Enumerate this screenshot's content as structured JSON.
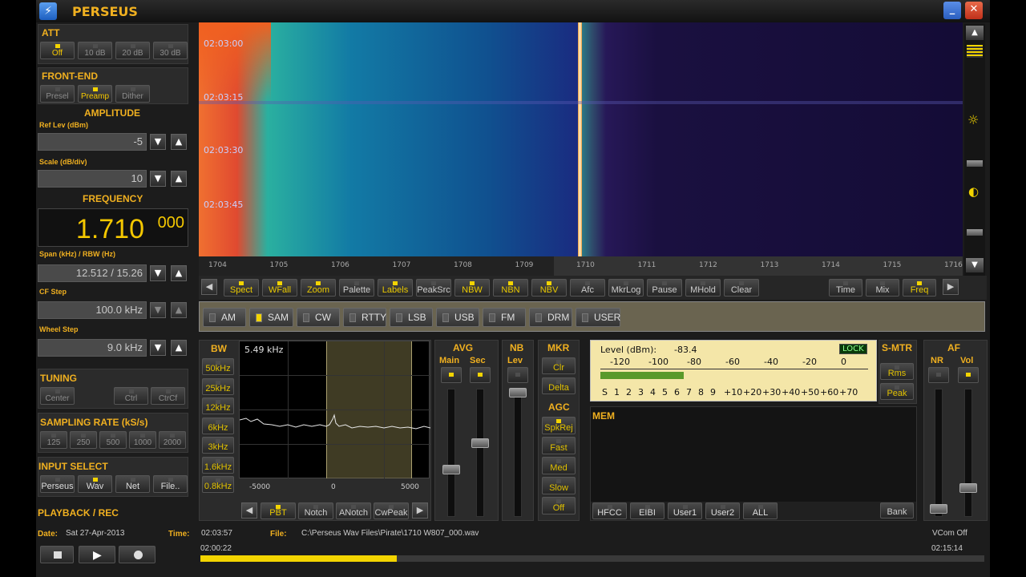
{
  "app": {
    "title": "PERSEUS"
  },
  "att": {
    "title": "ATT",
    "buttons": [
      {
        "label": "Off",
        "on": true
      },
      {
        "label": "10 dB",
        "on": false
      },
      {
        "label": "20 dB",
        "on": false
      },
      {
        "label": "30 dB",
        "on": false
      }
    ]
  },
  "frontend": {
    "title": "FRONT-END",
    "buttons": [
      {
        "label": "Presel",
        "on": false
      },
      {
        "label": "Preamp",
        "on": true
      },
      {
        "label": "Dither",
        "on": false
      }
    ]
  },
  "amplitude": {
    "title": "AMPLITUDE",
    "ref_label": "Ref Lev (dBm)",
    "ref_value": "-5",
    "scale_label": "Scale (dB/div)",
    "scale_value": "10"
  },
  "frequency": {
    "title": "FREQUENCY",
    "main": "1.710",
    "sub": "000",
    "span_label": "Span (kHz) / RBW (Hz)",
    "span_value": "12.512 / 15.26",
    "cf_label": "CF Step",
    "cf_value": "100.0 kHz",
    "wheel_label": "Wheel Step",
    "wheel_value": "9.0 kHz"
  },
  "tuning": {
    "title": "TUNING",
    "buttons": [
      "Center",
      "Ctrl",
      "CtrCf"
    ]
  },
  "sampling": {
    "title": "SAMPLING RATE (kS/s)",
    "buttons": [
      "125",
      "250",
      "500",
      "1000",
      "2000"
    ]
  },
  "input": {
    "title": "INPUT SELECT",
    "buttons": [
      {
        "label": "Perseus",
        "on": false
      },
      {
        "label": "Wav",
        "on": true
      },
      {
        "label": "Net",
        "on": false
      },
      {
        "label": "File..",
        "on": false
      }
    ]
  },
  "playback": {
    "title": "PLAYBACK / REC"
  },
  "waterfall": {
    "times": [
      "02:03:00",
      "02:03:15",
      "02:03:30",
      "02:03:45"
    ],
    "freq_ticks": [
      "1704",
      "1705",
      "1706",
      "1707",
      "1708",
      "1709",
      "1710",
      "1711",
      "1712",
      "1713",
      "1714",
      "1715",
      "1716"
    ]
  },
  "toolbar": {
    "buttons": [
      {
        "label": "Spect",
        "on": true
      },
      {
        "label": "WFall",
        "on": true
      },
      {
        "label": "Zoom",
        "on": true
      },
      {
        "label": "Palette",
        "on": false
      },
      {
        "label": "Labels",
        "on": true
      },
      {
        "label": "PeakSrc",
        "on": false
      },
      {
        "label": "NBW",
        "on": true
      },
      {
        "label": "NBN",
        "on": true
      },
      {
        "label": "NBV",
        "on": true
      },
      {
        "label": "Afc",
        "on": false
      },
      {
        "label": "MkrLog",
        "on": false
      },
      {
        "label": "Pause",
        "on": false
      },
      {
        "label": "MHold",
        "on": false
      },
      {
        "label": "Clear",
        "on": false
      }
    ],
    "right": [
      {
        "label": "Time",
        "on": false
      },
      {
        "label": "Mix",
        "on": false
      },
      {
        "label": "Freq",
        "on": true
      }
    ]
  },
  "modes": [
    {
      "label": "AM",
      "on": false
    },
    {
      "label": "SAM",
      "on": true
    },
    {
      "label": "CW",
      "on": false
    },
    {
      "label": "RTTY",
      "on": false
    },
    {
      "label": "LSB",
      "on": false
    },
    {
      "label": "USB",
      "on": false
    },
    {
      "label": "FM",
      "on": false
    },
    {
      "label": "DRM",
      "on": false
    },
    {
      "label": "USER",
      "on": false
    }
  ],
  "bw": {
    "title": "BW",
    "display": "5.49 kHz",
    "buttons": [
      "50kHz",
      "25kHz",
      "12kHz",
      "6kHz",
      "3kHz",
      "1.6kHz",
      "0.8kHz"
    ],
    "axis": [
      "-5000",
      "0",
      "5000"
    ]
  },
  "filter_buttons": [
    {
      "label": "PBT",
      "on": true
    },
    {
      "label": "Notch",
      "on": false
    },
    {
      "label": "ANotch",
      "on": false
    },
    {
      "label": "CwPeak",
      "on": false
    }
  ],
  "avg": {
    "title": "AVG",
    "main": "Main",
    "sec": "Sec"
  },
  "nb": {
    "title": "NB",
    "lev": "Lev"
  },
  "mkr": {
    "title": "MKR",
    "buttons": [
      "Clr",
      "Delta"
    ]
  },
  "agc": {
    "title": "AGC",
    "buttons": [
      {
        "label": "SpkRej",
        "on": true
      },
      {
        "label": "Fast",
        "on": false
      },
      {
        "label": "Med",
        "on": false
      },
      {
        "label": "Slow",
        "on": false
      },
      {
        "label": "Off",
        "on": false
      }
    ]
  },
  "meter": {
    "level_label": "Level (dBm):",
    "level_value": "-83.4",
    "lock": "LOCK",
    "dbm_scale": [
      "-120",
      "-100",
      "-80",
      "-60",
      "-40",
      "-20",
      "0"
    ],
    "s_scale": [
      "S",
      "1",
      "2",
      "3",
      "4",
      "5",
      "6",
      "7",
      "8",
      "9",
      "+10",
      "+20",
      "+30",
      "+40",
      "+50",
      "+60",
      "+70"
    ],
    "bar_fraction": 0.31
  },
  "smtr": {
    "title": "S-MTR",
    "buttons": [
      "Rms",
      "Peak"
    ]
  },
  "af": {
    "title": "AF",
    "nr": "NR",
    "vol": "Vol"
  },
  "mem": {
    "title": "MEM",
    "buttons": [
      "HFCC",
      "EIBI",
      "User1",
      "User2",
      "ALL"
    ],
    "bank": "Bank"
  },
  "status": {
    "date_label": "Date:",
    "date": "Sat 27-Apr-2013",
    "time_label": "Time:",
    "time": "02:03:57",
    "file_label": "File:",
    "file": "C:\\Perseus Wav Files\\Pirate\\1710 W807_000.wav",
    "vcom": "VCom Off",
    "start": "02:00:22",
    "end": "02:15:14",
    "progress": 0.25
  },
  "colors": {
    "accent": "#f0b020",
    "led": "#f3d400"
  }
}
